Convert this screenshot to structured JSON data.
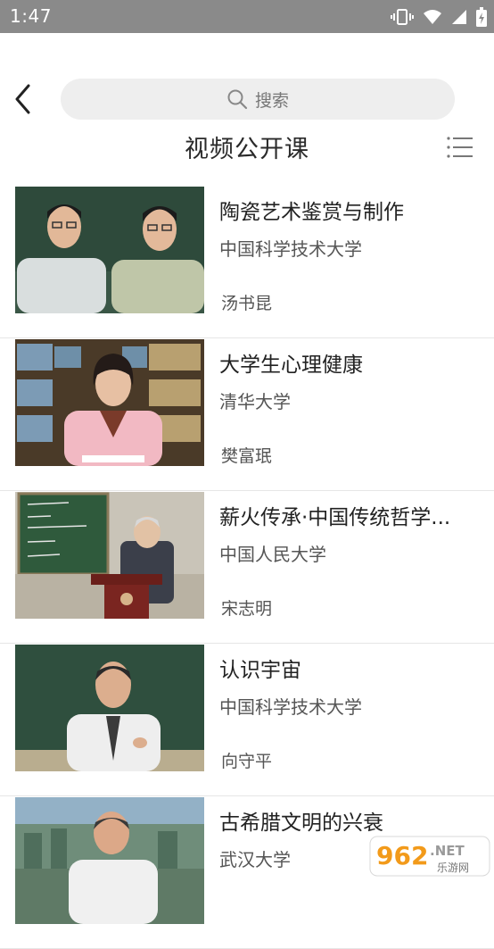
{
  "status_bar": {
    "time": "1:47"
  },
  "header": {
    "search_placeholder": "搜索",
    "title": "视频公开课"
  },
  "courses": [
    {
      "title": "陶瓷艺术鉴赏与制作",
      "school": "中国科学技术大学",
      "teacher": "汤书昆"
    },
    {
      "title": "大学生心理健康",
      "school": "清华大学",
      "teacher": "樊富珉"
    },
    {
      "title": "薪火传承·中国传统哲学...",
      "school": "中国人民大学",
      "teacher": "宋志明"
    },
    {
      "title": "认识宇宙",
      "school": "中国科学技术大学",
      "teacher": "向守平"
    },
    {
      "title": "古希腊文明的兴衰",
      "school": "武汉大学",
      "teacher": ""
    }
  ],
  "watermark": {
    "number": "962",
    "suffix": ".NET",
    "subtitle": "乐游网"
  }
}
